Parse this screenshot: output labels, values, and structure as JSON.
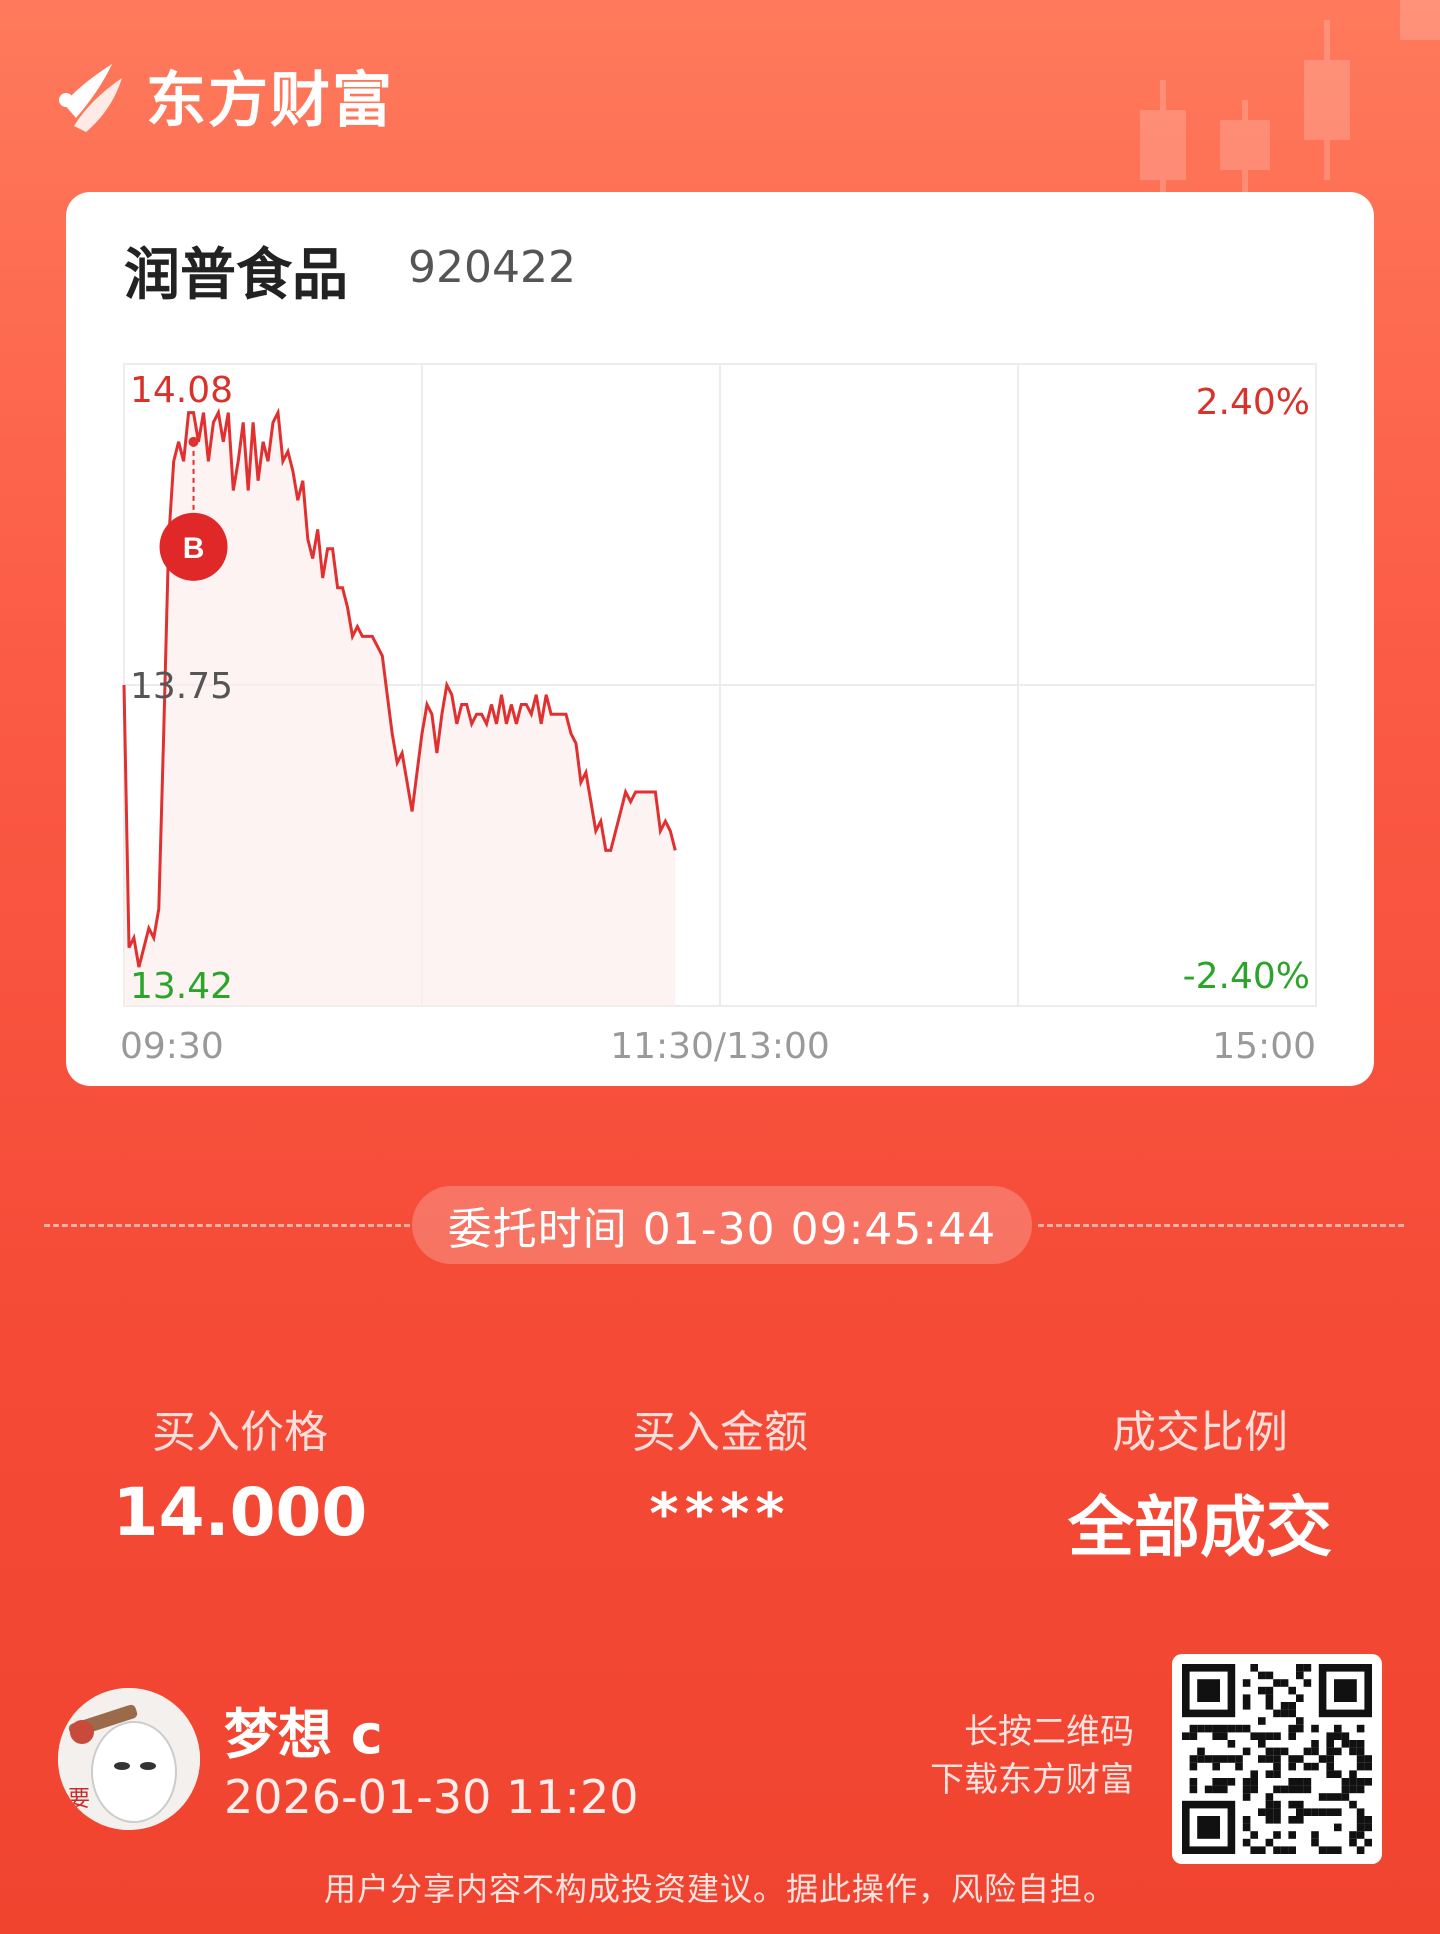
{
  "brand": {
    "name": "东方财富",
    "accent": "#f0442f"
  },
  "stock": {
    "name": "润普食品",
    "code": "920422"
  },
  "chart_data": {
    "type": "line",
    "price_ticks": {
      "max": "14.08",
      "mid": "13.75",
      "min": "13.42"
    },
    "pct_ticks": {
      "up": "2.40%",
      "down": "-2.40%"
    },
    "time_ticks": [
      "09:30",
      "11:30/13:00",
      "15:00"
    ],
    "ylim": [
      13.42,
      14.08
    ],
    "session_minutes": 240,
    "marker": {
      "label": "B",
      "minute": 14,
      "price": 14.0
    },
    "series": [
      {
        "x": [
          0,
          1,
          2,
          3,
          4,
          5,
          6,
          7,
          8,
          9,
          10,
          11,
          12,
          13,
          14,
          15,
          16,
          17,
          18,
          19,
          20,
          21,
          22,
          23,
          24,
          25,
          26,
          27,
          28,
          29,
          30,
          31,
          32,
          33,
          34,
          35,
          36,
          37,
          38,
          39,
          40,
          41,
          42,
          43,
          44,
          45,
          46,
          47,
          48,
          49,
          50,
          51,
          52,
          53,
          54,
          55,
          56,
          57,
          58,
          59,
          60,
          61,
          62,
          63,
          64,
          65,
          66,
          67,
          68,
          69,
          70,
          71,
          72,
          73,
          74,
          75,
          76,
          77,
          78,
          79,
          80,
          81,
          82,
          83,
          84,
          85,
          86,
          87,
          88,
          89,
          90,
          91,
          92,
          93,
          94,
          95,
          96,
          97,
          98,
          99,
          100,
          101,
          102,
          103,
          104,
          105,
          106,
          107,
          108,
          109,
          110,
          111
        ],
        "values": [
          13.75,
          13.48,
          13.49,
          13.46,
          13.48,
          13.5,
          13.49,
          13.52,
          13.7,
          13.9,
          13.98,
          14.0,
          13.98,
          14.03,
          14.03,
          14.0,
          14.03,
          13.98,
          14.02,
          14.03,
          14.0,
          14.03,
          13.95,
          13.98,
          14.02,
          13.95,
          14.02,
          13.96,
          14.0,
          13.98,
          14.02,
          14.03,
          13.98,
          13.99,
          13.97,
          13.94,
          13.96,
          13.9,
          13.88,
          13.91,
          13.86,
          13.89,
          13.89,
          13.85,
          13.85,
          13.83,
          13.8,
          13.81,
          13.8,
          13.8,
          13.8,
          13.79,
          13.78,
          13.74,
          13.7,
          13.67,
          13.68,
          13.65,
          13.62,
          13.66,
          13.7,
          13.73,
          13.72,
          13.68,
          13.72,
          13.75,
          13.74,
          13.71,
          13.73,
          13.73,
          13.71,
          13.72,
          13.72,
          13.71,
          13.73,
          13.71,
          13.74,
          13.71,
          13.73,
          13.71,
          13.73,
          13.73,
          13.72,
          13.74,
          13.71,
          13.74,
          13.72,
          13.72,
          13.72,
          13.72,
          13.7,
          13.69,
          13.65,
          13.66,
          13.63,
          13.6,
          13.61,
          13.58,
          13.58,
          13.6,
          13.62,
          13.64,
          13.63,
          13.64,
          13.64,
          13.64,
          13.64,
          13.64,
          13.6,
          13.61,
          13.6,
          13.58
        ]
      }
    ],
    "line_color": "#e03030"
  },
  "order": {
    "time_label": "委托时间 01-30 09:45:44"
  },
  "stats": [
    {
      "label": "买入价格",
      "value": "14.000"
    },
    {
      "label": "买入金额",
      "value": "****"
    },
    {
      "label": "成交比例",
      "value": "全部成交"
    }
  ],
  "user": {
    "name": "梦想 c",
    "time": "2026-01-30 11:20"
  },
  "qr": {
    "hint_line1": "长按二维码",
    "hint_line2": "下载东方财富"
  },
  "disclaimer": "用户分享内容不构成投资建议。据此操作，风险自担。"
}
